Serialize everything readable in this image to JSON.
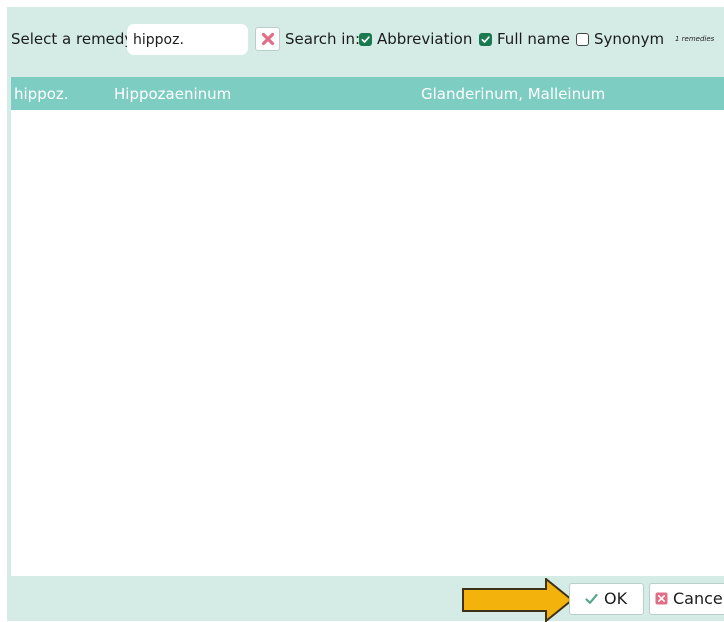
{
  "toolbar": {
    "select_label": "Select a remedy",
    "search_value": "hippoz.",
    "search_in_label": "Search in:",
    "abbreviation_label": "Abbreviation",
    "abbreviation_checked": true,
    "full_name_label": "Full name",
    "full_name_checked": true,
    "synonym_label": "Synonym",
    "synonym_checked": false,
    "result_count": "1 remedies"
  },
  "results": [
    {
      "abbreviation": "hippoz.",
      "full_name": "Hippozaeninum",
      "synonyms": "Glanderinum, Malleinum"
    }
  ],
  "footer": {
    "ok_label": "OK",
    "cancel_label": "Cancel"
  },
  "icons": {
    "clear": "clear-x-icon",
    "checkbox_checked": "checkmark-icon",
    "ok": "checkmark-icon",
    "cancel": "cancel-x-icon",
    "pointer": "arrow-right-icon"
  },
  "colors": {
    "dialog_background": "#d5ebe6",
    "selected_row": "#7ecdc3",
    "checkbox": "#197a4f",
    "clear_icon": "#e06e86",
    "arrow": "#f4b20c"
  }
}
